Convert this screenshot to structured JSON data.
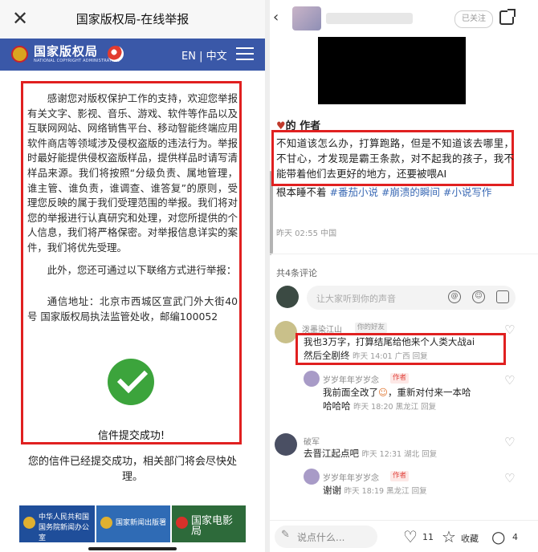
{
  "left": {
    "window_title": "国家版权局-在线举报",
    "org_name": "国家版权局",
    "org_name_en": "NATIONAL COPYRIGHT ADMINISTRATION",
    "lang_switch": "EN | 中文",
    "notice_para1": "感谢您对版权保护工作的支持，欢迎您举报有关文字、影视、音乐、游戏、软件等作品以及互联网网站、网络销售平台、移动智能终端应用软件商店等领域涉及侵权盗版的违法行为。举报时最好能提供侵权盗版样品，提供样品时请写清样品来源。我们将按照“分级负责、属地管理，谁主管、谁负责，谁调查、谁答复”的原则，受理您反映的属于我们受理范围的举报。我们将对您的举报进行认真研究和处理，对您所提供的个人信息，我们将严格保密。对举报信息详实的案件，我们将优先受理。",
    "notice_para2": "此外，您还可通过以下联络方式进行举报：",
    "notice_para3": "通信地址：北京市西城区宣武门外大街40号 国家版权局执法监管处收，邮编100052",
    "success_text": "信件提交成功!",
    "done_text": "您的信件已经提交成功，相关部门将会尽快处理。",
    "banners": [
      {
        "line1": "中华人民共和国",
        "line2": "国务院新闻办公室"
      },
      {
        "line1": "国家新闻出版署",
        "line2": ""
      },
      {
        "line1": "国家电影局",
        "line2": ""
      }
    ]
  },
  "right": {
    "follow_label": "已关注",
    "post_heading": "的  作者",
    "post_text": "不知道该怎么办，打算跑路，但是不知道该去哪里，不甘心，才发现是霸王条款，对不起我的孩子，我不能带着他们去更好的地方，还要被喂AI",
    "tags_lead": "根本睡不着",
    "tags": "#番茄小说 #崩溃的瞬间 #小说写作",
    "post_time": "昨天 02:55 中国",
    "comment_count": "共4条评论",
    "comment_placeholder": "让大家听到你的声音",
    "comments": [
      {
        "name": "泼墨染江山",
        "tag": "你的好友",
        "text_line1": "我也3万字，打算结尾给他来个人类大战ai",
        "text_line2": "然后全剧终",
        "meta": "昨天 14:01 广西 回复"
      },
      {
        "name": "岁岁年年岁岁念",
        "tag": "作者",
        "text_line1": "我前面全改了",
        "text_line2": "，重新对付来一本哈",
        "text_line3": "哈哈哈",
        "meta": "昨天 18:20 黑龙江 回复"
      },
      {
        "name": "破军",
        "tag": "",
        "text_line1": "去晋江起点吧",
        "meta": "昨天 12:31 湖北 回复"
      },
      {
        "name": "岁岁年年岁岁念",
        "tag": "作者",
        "text_line1": "谢谢",
        "meta": "昨天 18:19 黑龙江 回复"
      }
    ],
    "bottom_placeholder": "说点什么...",
    "likes": "11",
    "fav_label": "收藏",
    "comments_num": "4"
  }
}
